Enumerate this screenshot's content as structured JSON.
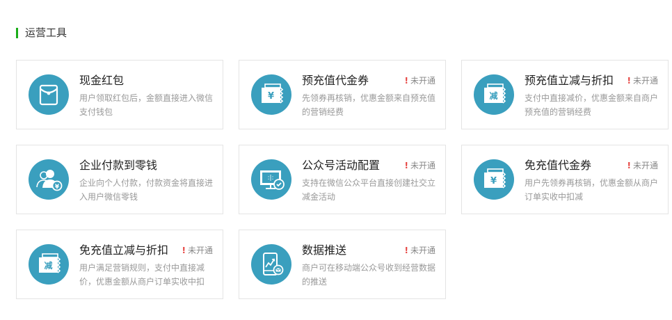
{
  "section": {
    "title": "运营工具"
  },
  "colors": {
    "accent_bar": "#1aad19",
    "icon_bg": "#3a9fbe",
    "status_alert": "#e64340"
  },
  "tools": [
    {
      "title": "现金红包",
      "desc": "用户领取红包后，金额直接进入微信支付钱包",
      "status": "",
      "icon": "red-envelope-icon"
    },
    {
      "title": "预充值代金券",
      "desc": "先领券再核销，优惠金额来自预充值的营销经费",
      "status": "未开通",
      "icon": "yuan-coupon-icon"
    },
    {
      "title": "预充值立减与折扣",
      "desc": "支付中直接减价，优惠金额来自商户预充值的营销经费",
      "status": "未开通",
      "icon": "discount-coupon-icon"
    },
    {
      "title": "企业付款到零钱",
      "desc": "企业向个人付款，付款资金将直接进入用户微信零钱",
      "status": "",
      "icon": "people-payment-icon"
    },
    {
      "title": "公众号活动配置",
      "desc": "支持在微信公众平台直接创建社交立减金活动",
      "status": "未开通",
      "icon": "monitor-settings-icon"
    },
    {
      "title": "免充值代金券",
      "desc": "用户先领券再核销，优惠金额从商户订单实收中扣减",
      "status": "未开通",
      "icon": "yuan-coupon-icon"
    },
    {
      "title": "免充值立减与折扣",
      "desc": "用户满足营销规则，支付中直接减价，优惠金额从商户订单实收中扣",
      "status": "未开通",
      "icon": "discount-coupon-icon"
    },
    {
      "title": "数据推送",
      "desc": "商户可在移动端公众号收到经营数据的推送",
      "status": "未开通",
      "icon": "mobile-chart-icon"
    }
  ]
}
